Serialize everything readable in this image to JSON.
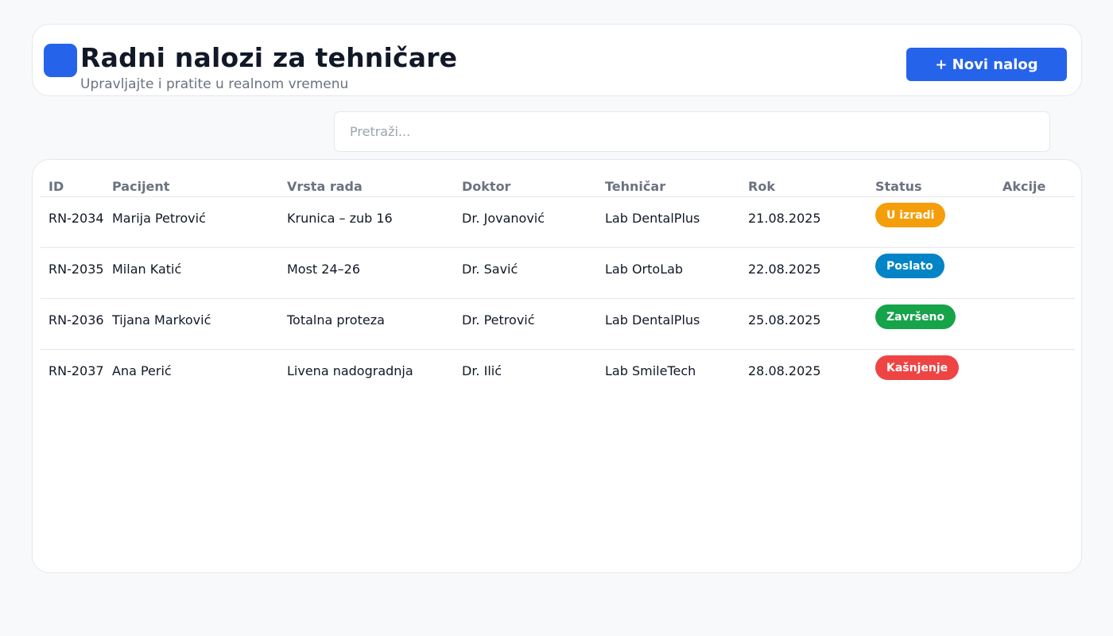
{
  "header": {
    "title": "Radni nalozi za tehničare",
    "subtitle": "Upravljajte i pratite u realnom vremenu",
    "new_button_label": "+ Novi nalog"
  },
  "search": {
    "placeholder": "Pretraži...",
    "value": ""
  },
  "table": {
    "columns": [
      "ID",
      "Pacijent",
      "Vrsta rada",
      "Doktor",
      "Tehničar",
      "Rok",
      "Status",
      "Akcije"
    ],
    "rows": [
      {
        "id": "RN-2034",
        "patient": "Marija Petrović",
        "work_type": "Krunica – zub 16",
        "doctor": "Dr. Jovanović",
        "technician": "Lab DentalPlus",
        "deadline": "21.08.2025",
        "status": "U izradi",
        "status_color": "#f59e0b"
      },
      {
        "id": "RN-2035",
        "patient": "Milan Katić",
        "work_type": "Most 24–26",
        "doctor": "Dr. Savić",
        "technician": "Lab OrtoLab",
        "deadline": "22.08.2025",
        "status": "Poslato",
        "status_color": "#0284c7"
      },
      {
        "id": "RN-2036",
        "patient": "Tijana Marković",
        "work_type": "Totalna proteza",
        "doctor": "Dr. Petrović",
        "technician": "Lab DentalPlus",
        "deadline": "25.08.2025",
        "status": "Završeno",
        "status_color": "#16a34a"
      },
      {
        "id": "RN-2037",
        "patient": "Ana Perić",
        "work_type": "Livena nadogradnja",
        "doctor": "Dr. Ilić",
        "technician": "Lab SmileTech",
        "deadline": "28.08.2025",
        "status": "Kašnjenje",
        "status_color": "#ef4444"
      }
    ]
  },
  "colors": {
    "accent": "#2563eb",
    "background": "#f8f9fb",
    "border": "#e5e7eb",
    "muted_text": "#6b7280"
  }
}
